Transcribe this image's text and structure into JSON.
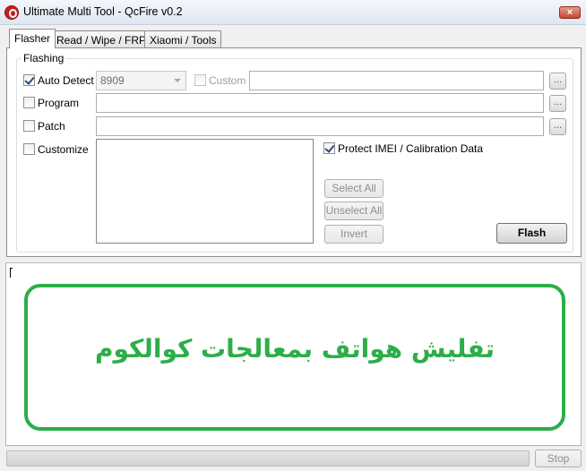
{
  "window": {
    "title": "Ultimate Multi Tool - QcFire v0.2",
    "close_label": "×"
  },
  "tabs": [
    {
      "label": "Flasher",
      "active": true
    },
    {
      "label": "Read / Wipe / FRP",
      "active": false
    },
    {
      "label": "Xiaomi / Tools",
      "active": false
    }
  ],
  "flashing": {
    "group_label": "Flashing",
    "auto_detect": {
      "label": "Auto Detect",
      "checked": true
    },
    "chip_select": {
      "value": "8909"
    },
    "custom": {
      "label": "Custom",
      "checked": false,
      "enabled": false
    },
    "program": {
      "label": "Program",
      "checked": false
    },
    "patch": {
      "label": "Patch",
      "checked": false
    },
    "customize": {
      "label": "Customize",
      "checked": false
    },
    "browse_label": "...",
    "protect_imei": {
      "label": "Protect IMEI / Calibration Data",
      "checked": true
    },
    "select_all_label": "Select All",
    "unselect_all_label": "Unselect All",
    "invert_label": "Invert",
    "flash_label": "Flash"
  },
  "log": {
    "banner_text": "تفليش هواتف بمعالجات كوالكوم",
    "accent_color": "#2cae48"
  },
  "status": {
    "stop_label": "Stop",
    "progress_percent": 0
  }
}
